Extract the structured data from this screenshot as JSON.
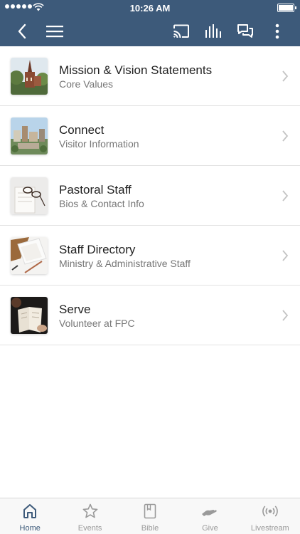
{
  "status_bar": {
    "time": "10:26 AM"
  },
  "nav": {
    "back_icon": "chevron-left-icon",
    "menu_icon": "hamburger-icon",
    "actions": [
      "cast-icon",
      "audio-bars-icon",
      "chat-icon",
      "more-vertical-icon"
    ]
  },
  "items": [
    {
      "title": "Mission & Vision Statements",
      "subtitle": "Core Values"
    },
    {
      "title": "Connect",
      "subtitle": "Visitor Information"
    },
    {
      "title": "Pastoral Staff",
      "subtitle": "Bios & Contact Info"
    },
    {
      "title": "Staff Directory",
      "subtitle": "Ministry & Administrative Staff"
    },
    {
      "title": "Serve",
      "subtitle": "Volunteer at FPC"
    }
  ],
  "tabs": [
    {
      "label": "Home",
      "icon": "home-icon",
      "active": true
    },
    {
      "label": "Events",
      "icon": "star-icon",
      "active": false
    },
    {
      "label": "Bible",
      "icon": "book-icon",
      "active": false
    },
    {
      "label": "Give",
      "icon": "hand-icon",
      "active": false
    },
    {
      "label": "Livestream",
      "icon": "broadcast-icon",
      "active": false
    }
  ],
  "colors": {
    "header": "#3d5a7a",
    "active_tab": "#3d5a7a",
    "inactive_tab": "#9a9a9a"
  }
}
